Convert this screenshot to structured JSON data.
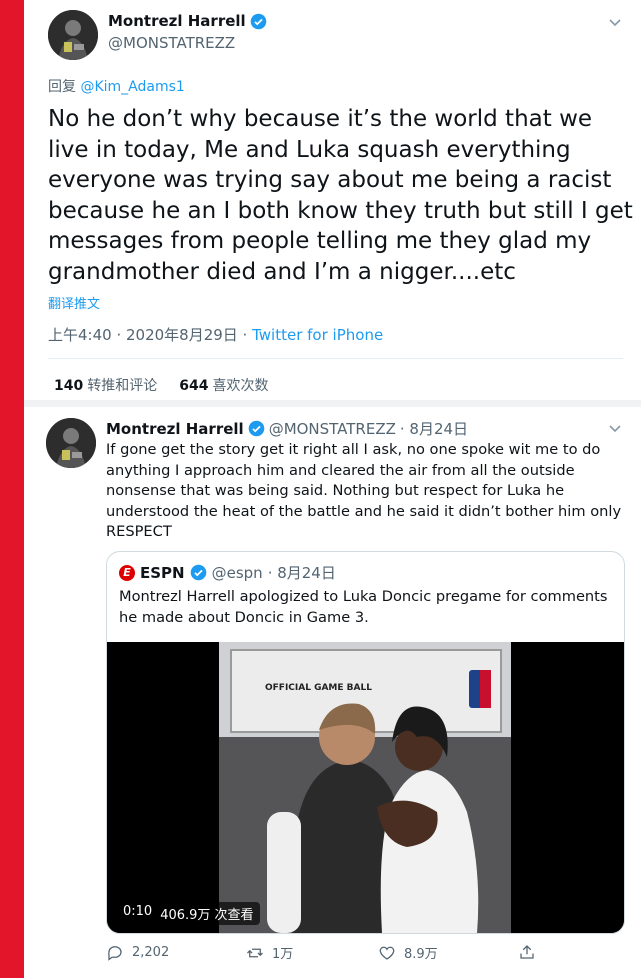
{
  "tweet1": {
    "author_name": "Montrezl Harrell",
    "author_handle": "@MONSTATREZZ",
    "reply_prefix": "回复",
    "reply_target": "@Kim_Adams1",
    "text": "No he don’t why because it’s the world that we live in today, Me and Luka squash everything everyone was trying say about me being a racist because he an I both know they truth but still I get messages from people telling me they glad my grandmother died and I’m a nigger....etc",
    "translate_label": "翻译推文",
    "time": "上午4:40 · 2020年8月29日 · ",
    "source": "Twitter for iPhone",
    "retweets_count": "140",
    "retweets_label": "转推和评论",
    "likes_count": "644",
    "likes_label": "喜欢次数"
  },
  "tweet2": {
    "author_name": "Montrezl Harrell",
    "author_handle": "@MONSTATREZZ",
    "date": "· 8月24日",
    "text": "If gone get the story get it right all I ask, no one spoke wit me to do anything I approach him and cleared the air from all the outside nonsense that was being said. Nothing but respect for Luka he understood the heat of the battle and he said it didn’t bother him only RESPECT",
    "quote": {
      "logo_letter": "E",
      "author_name": "ESPN",
      "author_handle": "@espn",
      "date": "· 8月24日",
      "text": "Montrezl Harrell apologized to Luka Doncic pregame for comments he made about Doncic in Game 3.",
      "video_time": "0:10",
      "video_views": "406.9万 次查看",
      "video_sign_text": "OFFICIAL GAME BALL"
    },
    "actions": {
      "replies": "2,202",
      "retweets": "1万",
      "likes": "8.9万"
    }
  },
  "colors": {
    "accent": "#1d9bf0",
    "side_bar": "#e3152a",
    "muted": "#536471"
  },
  "icons": [
    "verified-icon",
    "chevron-down-icon",
    "reply-icon",
    "retweet-icon",
    "like-icon",
    "share-icon",
    "espn-logo"
  ]
}
